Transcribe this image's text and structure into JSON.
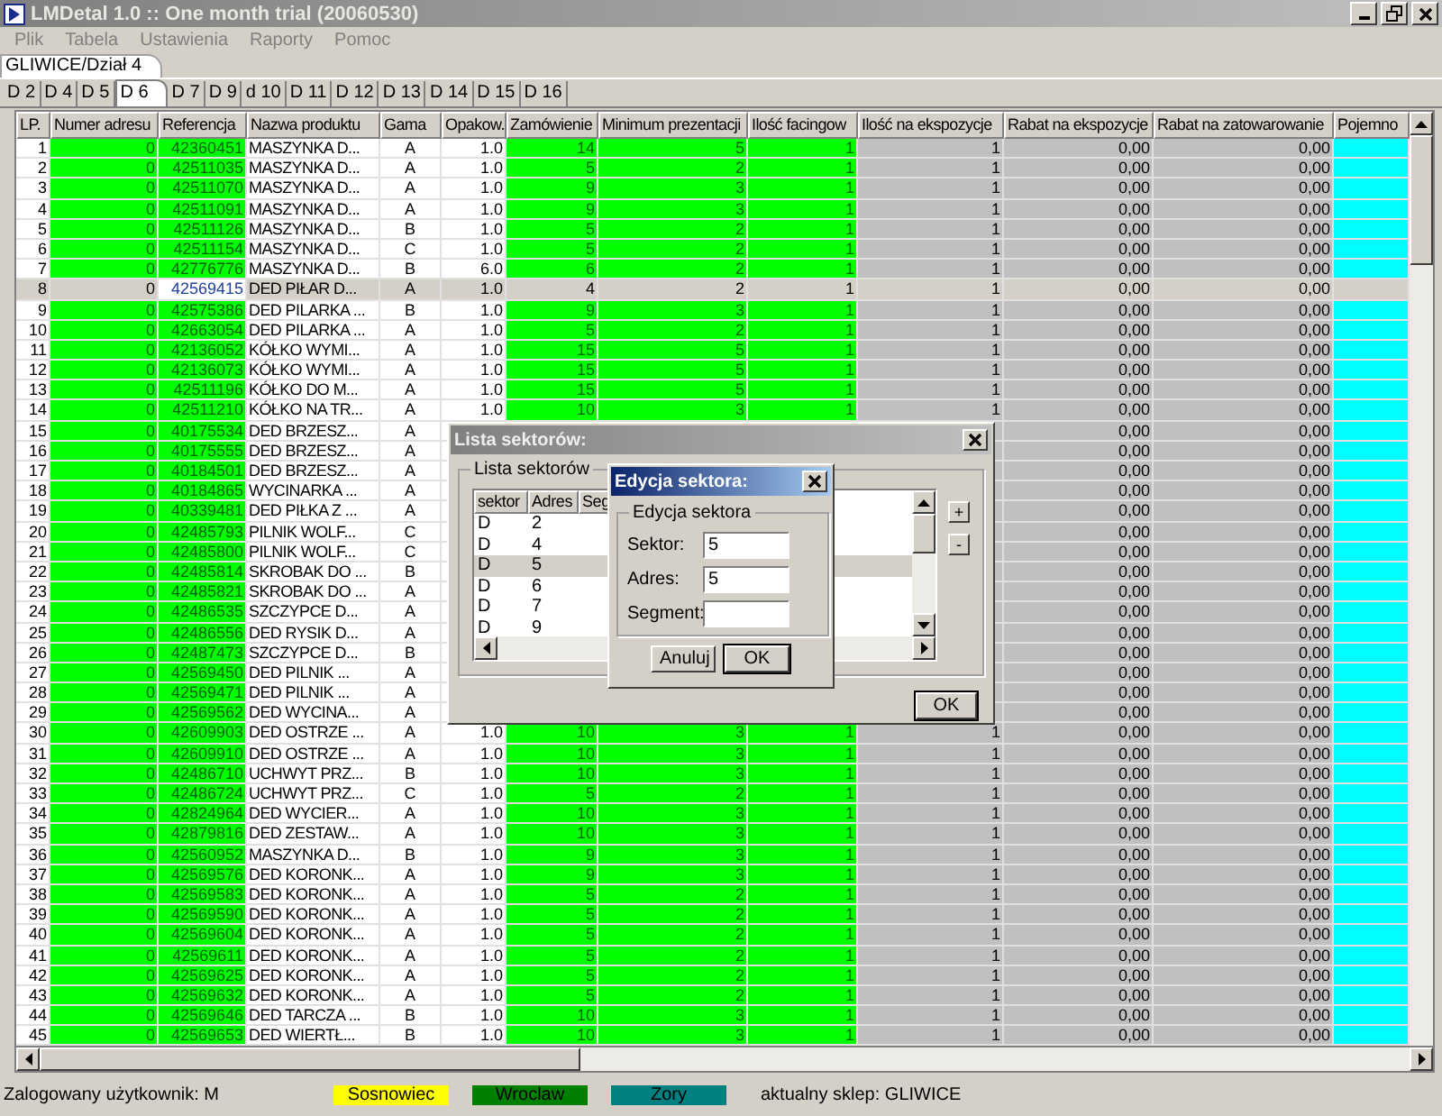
{
  "window": {
    "title": "LMDetal 1.0 :: One month trial (20060530)"
  },
  "menu": [
    {
      "label": "Plik",
      "disabled": true
    },
    {
      "label": "Tabela",
      "disabled": true
    },
    {
      "label": "Ustawienia",
      "disabled": true
    },
    {
      "label": "Raporty",
      "disabled": true
    },
    {
      "label": "Pomoc",
      "disabled": true
    }
  ],
  "location_tabs": [
    {
      "label": "GLIWICE/Dział 4",
      "selected": true
    }
  ],
  "sector_tabs": [
    {
      "label": "D 2",
      "selected": false
    },
    {
      "label": "D 4",
      "selected": false
    },
    {
      "label": "D 5",
      "selected": false
    },
    {
      "label": "D 6",
      "selected": true
    },
    {
      "label": "D 7",
      "selected": false
    },
    {
      "label": "D 9",
      "selected": false
    },
    {
      "label": "d 10",
      "selected": false
    },
    {
      "label": "D 11",
      "selected": false
    },
    {
      "label": "D 12",
      "selected": false
    },
    {
      "label": "D 13",
      "selected": false
    },
    {
      "label": "D 14",
      "selected": false
    },
    {
      "label": "D 15",
      "selected": false
    },
    {
      "label": "D 16",
      "selected": false
    }
  ],
  "table": {
    "columns": [
      "LP.",
      "Numer adresu",
      "Referencja",
      "Nazwa produktu",
      "Gama",
      "Opakow.",
      "Zamówienie",
      "Minimum prezentacji",
      "Ilość facingow",
      "Ilość na ekspozycje",
      "Rabat na ekspozycje",
      "Rabat na zatowarowanie",
      "Pojemno"
    ],
    "rows": [
      {
        "lp": "1",
        "address": "0",
        "reference": "42360451",
        "name": "MASZYNKA D...",
        "gama": "A",
        "package": "1.0",
        "order": "14",
        "min_presentation": "5",
        "facings": "1",
        "display_qty": "1",
        "display_discount": "0,00",
        "stock_discount": "0,00",
        "selected": false
      },
      {
        "lp": "2",
        "address": "0",
        "reference": "42511035",
        "name": "MASZYNKA D...",
        "gama": "A",
        "package": "1.0",
        "order": "5",
        "min_presentation": "2",
        "facings": "1",
        "display_qty": "1",
        "display_discount": "0,00",
        "stock_discount": "0,00",
        "selected": false
      },
      {
        "lp": "3",
        "address": "0",
        "reference": "42511070",
        "name": "MASZYNKA D...",
        "gama": "A",
        "package": "1.0",
        "order": "9",
        "min_presentation": "3",
        "facings": "1",
        "display_qty": "1",
        "display_discount": "0,00",
        "stock_discount": "0,00",
        "selected": false
      },
      {
        "lp": "4",
        "address": "0",
        "reference": "42511091",
        "name": "MASZYNKA D...",
        "gama": "A",
        "package": "1.0",
        "order": "9",
        "min_presentation": "3",
        "facings": "1",
        "display_qty": "1",
        "display_discount": "0,00",
        "stock_discount": "0,00",
        "selected": false
      },
      {
        "lp": "5",
        "address": "0",
        "reference": "42511126",
        "name": "MASZYNKA D...",
        "gama": "B",
        "package": "1.0",
        "order": "5",
        "min_presentation": "2",
        "facings": "1",
        "display_qty": "1",
        "display_discount": "0,00",
        "stock_discount": "0,00",
        "selected": false
      },
      {
        "lp": "6",
        "address": "0",
        "reference": "42511154",
        "name": "MASZYNKA D...",
        "gama": "C",
        "package": "1.0",
        "order": "5",
        "min_presentation": "2",
        "facings": "1",
        "display_qty": "1",
        "display_discount": "0,00",
        "stock_discount": "0,00",
        "selected": false
      },
      {
        "lp": "7",
        "address": "0",
        "reference": "42776776",
        "name": "MASZYNKA D...",
        "gama": "B",
        "package": "6.0",
        "order": "6",
        "min_presentation": "2",
        "facings": "1",
        "display_qty": "1",
        "display_discount": "0,00",
        "stock_discount": "0,00",
        "selected": false
      },
      {
        "lp": "8",
        "address": "0",
        "reference": "42569415",
        "name": "DED PIŁAR D...",
        "gama": "A",
        "package": "1.0",
        "order": "4",
        "min_presentation": "2",
        "facings": "1",
        "display_qty": "1",
        "display_discount": "0,00",
        "stock_discount": "0,00",
        "selected": true
      },
      {
        "lp": "9",
        "address": "0",
        "reference": "42575386",
        "name": "DED PILARKA ...",
        "gama": "B",
        "package": "1.0",
        "order": "9",
        "min_presentation": "3",
        "facings": "1",
        "display_qty": "1",
        "display_discount": "0,00",
        "stock_discount": "0,00",
        "selected": false
      },
      {
        "lp": "10",
        "address": "0",
        "reference": "42663054",
        "name": "DED PILARKA ...",
        "gama": "A",
        "package": "1.0",
        "order": "5",
        "min_presentation": "2",
        "facings": "1",
        "display_qty": "1",
        "display_discount": "0,00",
        "stock_discount": "0,00",
        "selected": false
      },
      {
        "lp": "11",
        "address": "0",
        "reference": "42136052",
        "name": "KÓŁKO WYMI...",
        "gama": "A",
        "package": "1.0",
        "order": "15",
        "min_presentation": "5",
        "facings": "1",
        "display_qty": "1",
        "display_discount": "0,00",
        "stock_discount": "0,00",
        "selected": false
      },
      {
        "lp": "12",
        "address": "0",
        "reference": "42136073",
        "name": "KÓŁKO WYMI...",
        "gama": "A",
        "package": "1.0",
        "order": "15",
        "min_presentation": "5",
        "facings": "1",
        "display_qty": "1",
        "display_discount": "0,00",
        "stock_discount": "0,00",
        "selected": false
      },
      {
        "lp": "13",
        "address": "0",
        "reference": "42511196",
        "name": "KÓŁKO DO M...",
        "gama": "A",
        "package": "1.0",
        "order": "15",
        "min_presentation": "5",
        "facings": "1",
        "display_qty": "1",
        "display_discount": "0,00",
        "stock_discount": "0,00",
        "selected": false
      },
      {
        "lp": "14",
        "address": "0",
        "reference": "42511210",
        "name": "KÓŁKO NA TR...",
        "gama": "A",
        "package": "1.0",
        "order": "10",
        "min_presentation": "3",
        "facings": "1",
        "display_qty": "1",
        "display_discount": "0,00",
        "stock_discount": "0,00",
        "selected": false
      },
      {
        "lp": "15",
        "address": "0",
        "reference": "40175534",
        "name": "DED BRZESZ...",
        "gama": "A",
        "display_discount": "0,00",
        "stock_discount": "0,00",
        "selected": false
      },
      {
        "lp": "16",
        "address": "0",
        "reference": "40175555",
        "name": "DED BRZESZ...",
        "gama": "A",
        "display_discount": "0,00",
        "stock_discount": "0,00",
        "selected": false
      },
      {
        "lp": "17",
        "address": "0",
        "reference": "40184501",
        "name": "DED BRZESZ...",
        "gama": "A",
        "display_discount": "0,00",
        "stock_discount": "0,00",
        "selected": false
      },
      {
        "lp": "18",
        "address": "0",
        "reference": "40184865",
        "name": "WYCINARKA ...",
        "gama": "A",
        "display_discount": "0,00",
        "stock_discount": "0,00",
        "selected": false
      },
      {
        "lp": "19",
        "address": "0",
        "reference": "40339481",
        "name": "DED PIŁKA Z ...",
        "gama": "A",
        "display_discount": "0,00",
        "stock_discount": "0,00",
        "selected": false
      },
      {
        "lp": "20",
        "address": "0",
        "reference": "42485793",
        "name": "PILNIK WOLF...",
        "gama": "C",
        "display_discount": "0,00",
        "stock_discount": "0,00",
        "selected": false
      },
      {
        "lp": "21",
        "address": "0",
        "reference": "42485800",
        "name": "PILNIK WOLF...",
        "gama": "C",
        "display_discount": "0,00",
        "stock_discount": "0,00",
        "selected": false
      },
      {
        "lp": "22",
        "address": "0",
        "reference": "42485814",
        "name": "SKROBAK DO ...",
        "gama": "B",
        "display_discount": "0,00",
        "stock_discount": "0,00",
        "selected": false
      },
      {
        "lp": "23",
        "address": "0",
        "reference": "42485821",
        "name": "SKROBAK DO ...",
        "gama": "A",
        "display_discount": "0,00",
        "stock_discount": "0,00",
        "selected": false
      },
      {
        "lp": "24",
        "address": "0",
        "reference": "42486535",
        "name": "SZCZYPCE D...",
        "gama": "A",
        "display_discount": "0,00",
        "stock_discount": "0,00",
        "selected": false
      },
      {
        "lp": "25",
        "address": "0",
        "reference": "42486556",
        "name": "DED RYSIK D...",
        "gama": "A",
        "display_discount": "0,00",
        "stock_discount": "0,00",
        "selected": false
      },
      {
        "lp": "26",
        "address": "0",
        "reference": "42487473",
        "name": "SZCZYPCE D...",
        "gama": "B",
        "display_discount": "0,00",
        "stock_discount": "0,00",
        "selected": false
      },
      {
        "lp": "27",
        "address": "0",
        "reference": "42569450",
        "name": "DED PILNIK ...",
        "gama": "A",
        "display_discount": "0,00",
        "stock_discount": "0,00",
        "selected": false
      },
      {
        "lp": "28",
        "address": "0",
        "reference": "42569471",
        "name": "DED PILNIK ...",
        "gama": "A",
        "display_discount": "0,00",
        "stock_discount": "0,00",
        "selected": false
      },
      {
        "lp": "29",
        "address": "0",
        "reference": "42569562",
        "name": "DED WYCINA...",
        "gama": "A",
        "display_discount": "0,00",
        "stock_discount": "0,00",
        "selected": false
      },
      {
        "lp": "30",
        "address": "0",
        "reference": "42609903",
        "name": "DED OSTRZE ...",
        "gama": "A",
        "package": "1.0",
        "order": "10",
        "min_presentation": "3",
        "facings": "1",
        "display_qty": "1",
        "display_discount": "0,00",
        "stock_discount": "0,00",
        "selected": false
      },
      {
        "lp": "31",
        "address": "0",
        "reference": "42609910",
        "name": "DED OSTRZE ...",
        "gama": "A",
        "package": "1.0",
        "order": "10",
        "min_presentation": "3",
        "facings": "1",
        "display_qty": "1",
        "display_discount": "0,00",
        "stock_discount": "0,00",
        "selected": false
      },
      {
        "lp": "32",
        "address": "0",
        "reference": "42486710",
        "name": "UCHWYT PRZ...",
        "gama": "B",
        "package": "1.0",
        "order": "10",
        "min_presentation": "3",
        "facings": "1",
        "display_qty": "1",
        "display_discount": "0,00",
        "stock_discount": "0,00",
        "selected": false
      },
      {
        "lp": "33",
        "address": "0",
        "reference": "42486724",
        "name": "UCHWYT PRZ...",
        "gama": "C",
        "package": "1.0",
        "order": "5",
        "min_presentation": "2",
        "facings": "1",
        "display_qty": "1",
        "display_discount": "0,00",
        "stock_discount": "0,00",
        "selected": false
      },
      {
        "lp": "34",
        "address": "0",
        "reference": "42824964",
        "name": "DED WYCIER...",
        "gama": "A",
        "package": "1.0",
        "order": "10",
        "min_presentation": "3",
        "facings": "1",
        "display_qty": "1",
        "display_discount": "0,00",
        "stock_discount": "0,00",
        "selected": false
      },
      {
        "lp": "35",
        "address": "0",
        "reference": "42879816",
        "name": "DED ZESTAW...",
        "gama": "A",
        "package": "1.0",
        "order": "10",
        "min_presentation": "3",
        "facings": "1",
        "display_qty": "1",
        "display_discount": "0,00",
        "stock_discount": "0,00",
        "selected": false
      },
      {
        "lp": "36",
        "address": "0",
        "reference": "42560952",
        "name": "MASZYNKA D...",
        "gama": "B",
        "package": "1.0",
        "order": "9",
        "min_presentation": "3",
        "facings": "1",
        "display_qty": "1",
        "display_discount": "0,00",
        "stock_discount": "0,00",
        "selected": false
      },
      {
        "lp": "37",
        "address": "0",
        "reference": "42569576",
        "name": "DED KORONK...",
        "gama": "A",
        "package": "1.0",
        "order": "9",
        "min_presentation": "3",
        "facings": "1",
        "display_qty": "1",
        "display_discount": "0,00",
        "stock_discount": "0,00",
        "selected": false
      },
      {
        "lp": "38",
        "address": "0",
        "reference": "42569583",
        "name": "DED KORONK...",
        "gama": "A",
        "package": "1.0",
        "order": "5",
        "min_presentation": "2",
        "facings": "1",
        "display_qty": "1",
        "display_discount": "0,00",
        "stock_discount": "0,00",
        "selected": false
      },
      {
        "lp": "39",
        "address": "0",
        "reference": "42569590",
        "name": "DED KORONK...",
        "gama": "A",
        "package": "1.0",
        "order": "5",
        "min_presentation": "2",
        "facings": "1",
        "display_qty": "1",
        "display_discount": "0,00",
        "stock_discount": "0,00",
        "selected": false
      },
      {
        "lp": "40",
        "address": "0",
        "reference": "42569604",
        "name": "DED KORONK...",
        "gama": "A",
        "package": "1.0",
        "order": "5",
        "min_presentation": "2",
        "facings": "1",
        "display_qty": "1",
        "display_discount": "0,00",
        "stock_discount": "0,00",
        "selected": false
      },
      {
        "lp": "41",
        "address": "0",
        "reference": "42569611",
        "name": "DED KORONK...",
        "gama": "A",
        "package": "1.0",
        "order": "5",
        "min_presentation": "2",
        "facings": "1",
        "display_qty": "1",
        "display_discount": "0,00",
        "stock_discount": "0,00",
        "selected": false
      },
      {
        "lp": "42",
        "address": "0",
        "reference": "42569625",
        "name": "DED KORONK...",
        "gama": "A",
        "package": "1.0",
        "order": "5",
        "min_presentation": "2",
        "facings": "1",
        "display_qty": "1",
        "display_discount": "0,00",
        "stock_discount": "0,00",
        "selected": false
      },
      {
        "lp": "43",
        "address": "0",
        "reference": "42569632",
        "name": "DED KORONK...",
        "gama": "A",
        "package": "1.0",
        "order": "5",
        "min_presentation": "2",
        "facings": "1",
        "display_qty": "1",
        "display_discount": "0,00",
        "stock_discount": "0,00",
        "selected": false
      },
      {
        "lp": "44",
        "address": "0",
        "reference": "42569646",
        "name": "DED TARCZA ...",
        "gama": "B",
        "package": "1.0",
        "order": "10",
        "min_presentation": "3",
        "facings": "1",
        "display_qty": "1",
        "display_discount": "0,00",
        "stock_discount": "0,00",
        "selected": false
      },
      {
        "lp": "45",
        "address": "0",
        "reference": "42569653",
        "name": "DED WIERTŁ...",
        "gama": "B",
        "package": "1.0",
        "order": "10",
        "min_presentation": "3",
        "facings": "1",
        "display_qty": "1",
        "display_discount": "0,00",
        "stock_discount": "0,00",
        "selected": false
      }
    ]
  },
  "sector_list_dialog": {
    "title": "Lista sektorów:",
    "group_label": "Lista sektorów",
    "columns": [
      "sektor",
      "Adres",
      "Seg"
    ],
    "rows": [
      {
        "sector": "D",
        "address": "2",
        "selected": false
      },
      {
        "sector": "D",
        "address": "4",
        "selected": false
      },
      {
        "sector": "D",
        "address": "5",
        "selected": true
      },
      {
        "sector": "D",
        "address": "6",
        "selected": false
      },
      {
        "sector": "D",
        "address": "7",
        "selected": false
      },
      {
        "sector": "D",
        "address": "9",
        "selected": false
      }
    ],
    "side_buttons": [
      "+",
      "-"
    ],
    "ok_button": "OK"
  },
  "edit_dialog": {
    "title": "Edycja sektora:",
    "group_label": "Edycja sektora",
    "fields": [
      {
        "label": "Sektor:",
        "value": "5"
      },
      {
        "label": "Adres:",
        "value": "5"
      },
      {
        "label": "Segment:"
      }
    ],
    "buttons": [
      {
        "label": "Anuluj",
        "default": false
      },
      {
        "label": "OK",
        "default": true
      }
    ]
  },
  "status_bar": {
    "user": "Zalogowany użytkownik: M",
    "legend": [
      {
        "label": "Sosnowiec",
        "color": "#ffff00"
      },
      {
        "label": "Wroclaw",
        "color": "#008000"
      },
      {
        "label": "Zory",
        "color": "#008080"
      }
    ],
    "store": "aktualny sklep: GLIWICE"
  }
}
